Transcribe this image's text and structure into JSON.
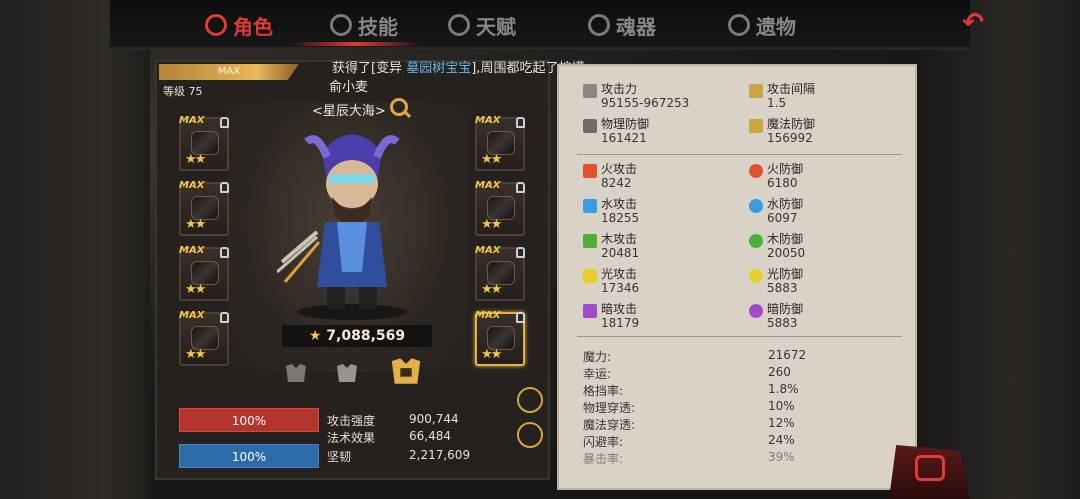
{
  "tabs": [
    {
      "label": "角色",
      "icon": "character-icon",
      "active": true
    },
    {
      "label": "技能",
      "icon": "skill-icon",
      "active": false
    },
    {
      "label": "天赋",
      "icon": "talent-icon",
      "active": false
    },
    {
      "label": "魂器",
      "icon": "soul-vessel-icon",
      "active": false
    },
    {
      "label": "遗物",
      "icon": "relic-icon",
      "active": false
    }
  ],
  "back_icon": "back-arrow-icon",
  "notice": {
    "prefix": "获得了[变异 ",
    "highlight": "墓园树宝宝",
    "suffix": "],周围都吃起了柠檬。"
  },
  "character": {
    "max_label": "MAX",
    "level": "等级 75",
    "name": "俞小麦",
    "guild": "<星辰大海>",
    "power": "7,088,569",
    "equipment_slots": [
      {
        "max": "MAX",
        "stars": "★★"
      },
      {
        "max": "MAX",
        "stars": "★★"
      },
      {
        "max": "MAX",
        "stars": "★★"
      },
      {
        "max": "MAX",
        "stars": "★★"
      },
      {
        "max": "MAX",
        "stars": "★★"
      },
      {
        "max": "MAX",
        "stars": "★★"
      },
      {
        "max": "MAX",
        "stars": "★★"
      },
      {
        "max": "MAX",
        "stars": "★★"
      }
    ],
    "bars": [
      {
        "percent": "100%",
        "label": "攻击强度",
        "value": "900,744"
      },
      {
        "label": "法术效果",
        "value": "66,484"
      },
      {
        "percent": "100%",
        "label": "坚韧",
        "value": "2,217,609"
      }
    ]
  },
  "stats": {
    "primary": [
      {
        "label": "攻击力",
        "value": "95155-967253",
        "icon": "sword-icon"
      },
      {
        "label": "攻击间隔",
        "value": "1.5",
        "icon": "speed-icon"
      },
      {
        "label": "物理防御",
        "value": "161421",
        "icon": "armor-icon"
      },
      {
        "label": "魔法防御",
        "value": "156992",
        "icon": "magic-shield-icon"
      }
    ],
    "elements": [
      {
        "label": "火攻击",
        "value": "8242",
        "color": "#e0522d"
      },
      {
        "label": "火防御",
        "value": "6180",
        "color": "#e0522d"
      },
      {
        "label": "水攻击",
        "value": "18255",
        "color": "#3d9be0"
      },
      {
        "label": "水防御",
        "value": "6097",
        "color": "#3d9be0"
      },
      {
        "label": "木攻击",
        "value": "20481",
        "color": "#4fae3a"
      },
      {
        "label": "木防御",
        "value": "20050",
        "color": "#4fae3a"
      },
      {
        "label": "光攻击",
        "value": "17346",
        "color": "#e6cf2b"
      },
      {
        "label": "光防御",
        "value": "5883",
        "color": "#e6cf2b"
      },
      {
        "label": "暗攻击",
        "value": "18179",
        "color": "#a04bc8"
      },
      {
        "label": "暗防御",
        "value": "5883",
        "color": "#a04bc8"
      }
    ],
    "misc": [
      {
        "label": "魔力:",
        "value": "21672"
      },
      {
        "label": "幸运:",
        "value": "260"
      },
      {
        "label": "格挡率:",
        "value": "1.8%"
      },
      {
        "label": "物理穿透:",
        "value": "10%"
      },
      {
        "label": "魔法穿透:",
        "value": "12%"
      },
      {
        "label": "闪避率:",
        "value": "24%"
      },
      {
        "label": "暴击率:",
        "value": "39%"
      }
    ]
  }
}
